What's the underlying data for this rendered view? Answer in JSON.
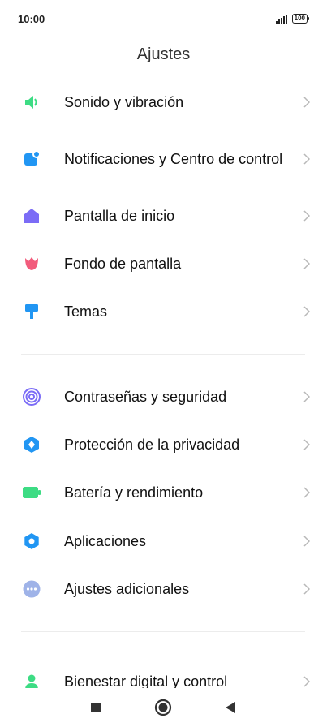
{
  "status_bar": {
    "time": "10:00",
    "battery": "100"
  },
  "header": {
    "title": "Ajustes"
  },
  "sections": [
    {
      "items": [
        {
          "label": "Sonido y vibración",
          "icon": "speaker-icon",
          "color": "#3ddc84"
        },
        {
          "label": "Notificaciones y Centro de control",
          "icon": "notification-icon",
          "color": "#2196f3"
        },
        {
          "label": "Pantalla de inicio",
          "icon": "home-icon",
          "color": "#7b6cf6"
        },
        {
          "label": "Fondo de pantalla",
          "icon": "flower-icon",
          "color": "#f25c7c"
        },
        {
          "label": "Temas",
          "icon": "paint-roller-icon",
          "color": "#2196f3"
        }
      ]
    },
    {
      "items": [
        {
          "label": "Contraseñas y seguridad",
          "icon": "fingerprint-icon",
          "color": "#7b6cf6"
        },
        {
          "label": "Protección de la privacidad",
          "icon": "privacy-shield-icon",
          "color": "#2196f3"
        },
        {
          "label": "Batería y rendimiento",
          "icon": "battery-icon",
          "color": "#3ddc84"
        },
        {
          "label": "Aplicaciones",
          "icon": "gear-icon",
          "color": "#2196f3"
        },
        {
          "label": "Ajustes adicionales",
          "icon": "more-dots-icon",
          "color": "#9fb3e8"
        }
      ]
    },
    {
      "items": [
        {
          "label": "Bienestar digital y control",
          "icon": "person-icon",
          "color": "#3ddc84"
        }
      ]
    }
  ],
  "nav_bar": {
    "recents": "square-icon",
    "home": "circle-icon",
    "back": "triangle-back-icon"
  }
}
